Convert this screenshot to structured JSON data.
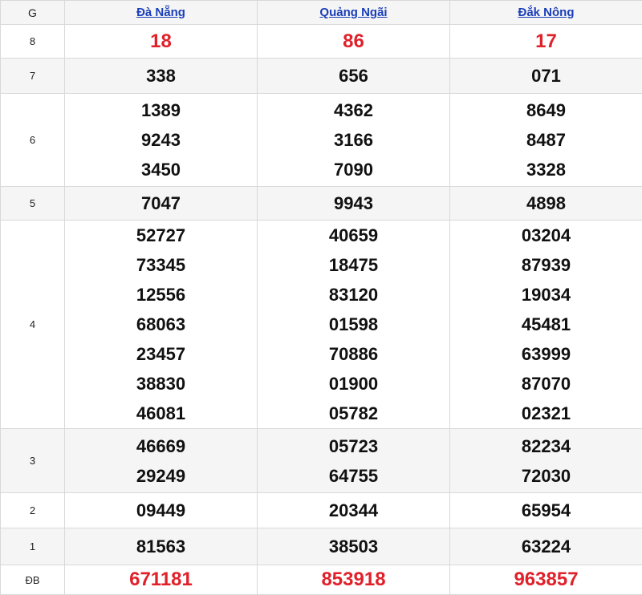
{
  "header": {
    "prize_col": "G",
    "provinces": [
      "Đà Nẵng",
      "Quảng Ngãi",
      "Đắk Nông"
    ]
  },
  "prizes": {
    "g8": {
      "label": "8",
      "values": [
        "18",
        "86",
        "17"
      ]
    },
    "g7": {
      "label": "7",
      "values": [
        "338",
        "656",
        "071"
      ]
    },
    "g6": {
      "label": "6",
      "values": [
        [
          "1389",
          "9243",
          "3450"
        ],
        [
          "4362",
          "3166",
          "7090"
        ],
        [
          "8649",
          "8487",
          "3328"
        ]
      ]
    },
    "g5": {
      "label": "5",
      "values": [
        "7047",
        "9943",
        "4898"
      ]
    },
    "g4": {
      "label": "4",
      "values": [
        [
          "52727",
          "73345",
          "12556",
          "68063",
          "23457",
          "38830",
          "46081"
        ],
        [
          "40659",
          "18475",
          "83120",
          "01598",
          "70886",
          "01900",
          "05782"
        ],
        [
          "03204",
          "87939",
          "19034",
          "45481",
          "63999",
          "87070",
          "02321"
        ]
      ]
    },
    "g3": {
      "label": "3",
      "values": [
        [
          "46669",
          "29249"
        ],
        [
          "05723",
          "64755"
        ],
        [
          "82234",
          "72030"
        ]
      ]
    },
    "g2": {
      "label": "2",
      "values": [
        "09449",
        "20344",
        "65954"
      ]
    },
    "g1": {
      "label": "1",
      "values": [
        "81563",
        "38503",
        "63224"
      ]
    },
    "db": {
      "label": "ĐB",
      "values": [
        "671181",
        "853918",
        "963857"
      ]
    }
  },
  "colors": {
    "accent_red": "#e0212a",
    "link_blue": "#1a3eb8",
    "row_alt": "#f5f5f5"
  }
}
